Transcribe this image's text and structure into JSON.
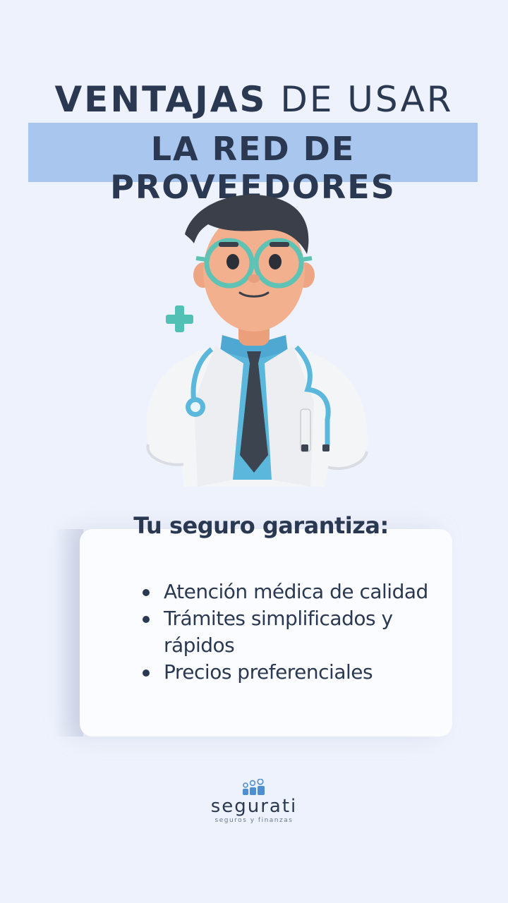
{
  "title": {
    "line1_bold": "VENTAJAS",
    "line1_light": " DE USAR",
    "line2": "LA RED DE PROVEEDORES"
  },
  "illustration": {
    "icon": "doctor-avatar-icon",
    "plus_icon": "medical-cross-icon"
  },
  "card": {
    "title": "Tu seguro garantiza:",
    "items": [
      "Atención médica de calidad",
      "Trámites simplificados y rápidos",
      "Precios preferenciales"
    ]
  },
  "brand": {
    "name": "segurati",
    "tagline": "seguros y finanzas",
    "icon": "people-group-icon"
  },
  "colors": {
    "background": "#eef2fc",
    "band": "#a9c6ee",
    "text": "#2b3852",
    "accent": "#4fbfb8"
  }
}
